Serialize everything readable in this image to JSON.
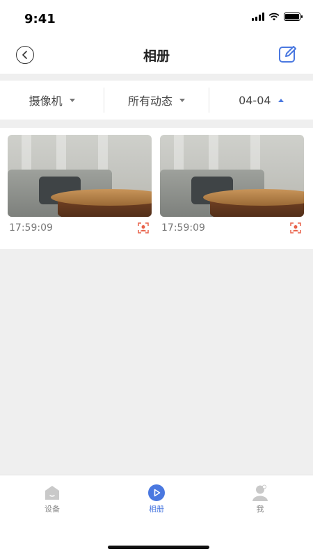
{
  "status_bar": {
    "time": "9:41"
  },
  "nav": {
    "title": "相册"
  },
  "filters": [
    {
      "label": "摄像机",
      "caret": "down"
    },
    {
      "label": "所有动态",
      "caret": "down"
    },
    {
      "label": "04-04",
      "caret": "up"
    }
  ],
  "photos": [
    {
      "time": "17:59:09",
      "badge_icon": "face-recognition-icon"
    },
    {
      "time": "17:59:09",
      "badge_icon": "face-recognition-icon"
    }
  ],
  "tab_bar": {
    "items": [
      {
        "label": "设备",
        "icon": "home-icon",
        "active": false
      },
      {
        "label": "相册",
        "icon": "play-icon",
        "active": true
      },
      {
        "label": "我",
        "icon": "profile-icon",
        "active": false
      }
    ]
  },
  "colors": {
    "accent": "#4a78e0",
    "badge": "#e8624a",
    "background": "#efefef"
  }
}
